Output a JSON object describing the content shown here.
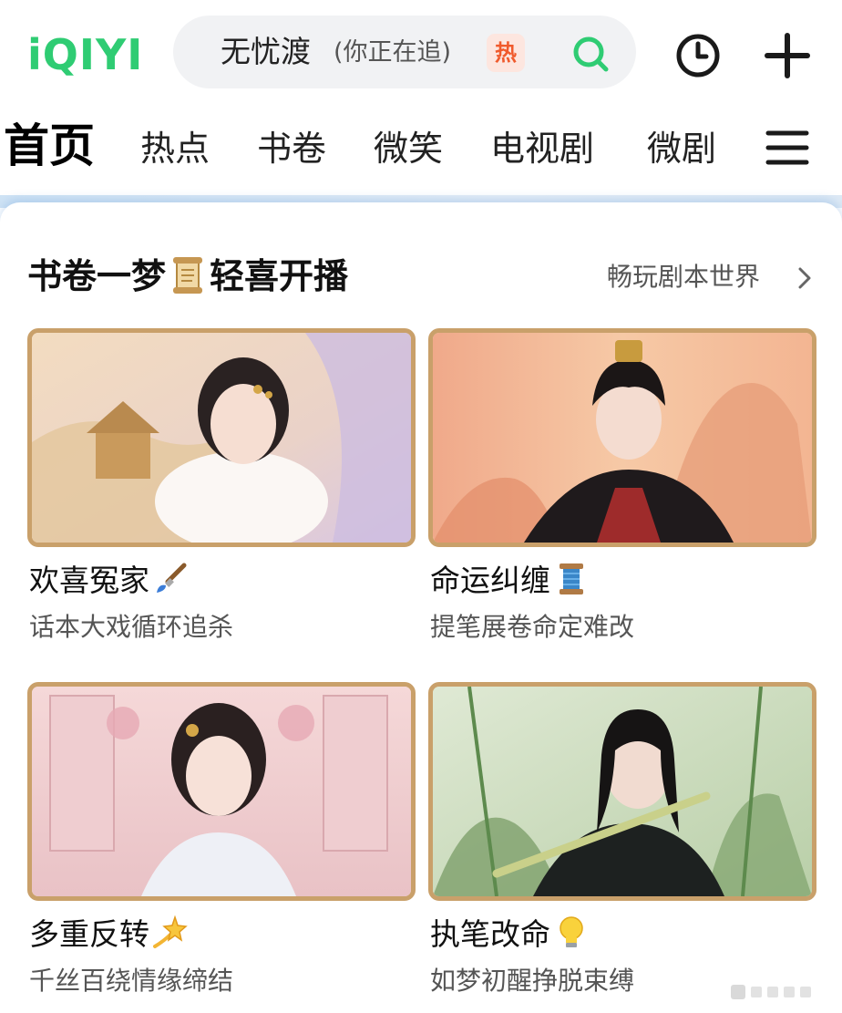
{
  "header": {
    "logo": "iQIYI",
    "search_text": "无忧渡",
    "search_sub": "(你正在追)",
    "hot_badge": "热"
  },
  "tabs": [
    {
      "label": "首页",
      "active": true
    },
    {
      "label": "热点"
    },
    {
      "label": "书卷"
    },
    {
      "label": "微笑"
    },
    {
      "label": "电视剧"
    },
    {
      "label": "微剧"
    }
  ],
  "section": {
    "title_a": "书卷一梦",
    "title_b": "轻喜开播",
    "more": "畅玩剧本世界"
  },
  "tiles": [
    {
      "title": "欢喜冤家",
      "subtitle": "话本大戏循环追杀",
      "emoji": "paintbrush-icon"
    },
    {
      "title": "命运纠缠",
      "subtitle": "提笔展卷命定难改",
      "emoji": "thread-spool-icon"
    },
    {
      "title": "多重反转",
      "subtitle": "千丝百绕情缘缔结",
      "emoji": "dizzy-star-icon"
    },
    {
      "title": "执笔改命",
      "subtitle": "如梦初醒挣脱束缚",
      "emoji": "light-bulb-icon"
    }
  ],
  "colors": {
    "brand": "#2fcc73",
    "search_icon": "#2fcc73",
    "hot_badge_bg": "#fde6df",
    "hot_badge_text": "#f05a2c",
    "frame_gold": "#c9a06a"
  }
}
